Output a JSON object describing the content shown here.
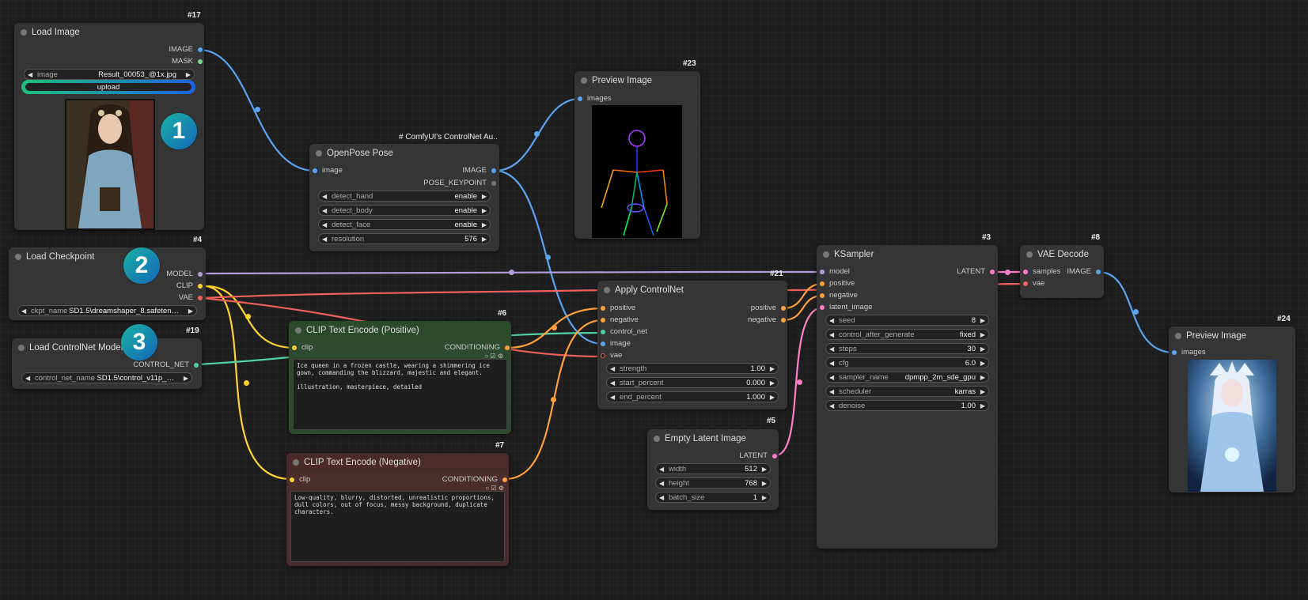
{
  "colors": {
    "image_wire": "#5aa4f0",
    "model_wire": "#b39ddb",
    "clip_wire": "#ffd233",
    "vae_wire": "#f0605d",
    "control_net_wire": "#4fd1a5",
    "conditioning_wire": "#ffa13d",
    "latent_wire": "#ff80c8",
    "positive_node_bg": "#2f4a2f",
    "negative_node_bg": "#4a2c2c",
    "upload_gradient_start": "#1ec27a",
    "upload_gradient_end": "#1e62e0"
  },
  "load_image": {
    "id": "#17",
    "title": "Load Image",
    "outputs": [
      "IMAGE",
      "MASK"
    ],
    "image_label": "image",
    "image_value": "Result_00053_@1x.jpg",
    "upload_label": "upload",
    "badge": "1"
  },
  "load_checkpoint": {
    "id": "#4",
    "title": "Load Checkpoint",
    "outputs": [
      "MODEL",
      "CLIP",
      "VAE"
    ],
    "ckpt_label": "ckpt_name",
    "ckpt_value": "SD1.5\\dreamshaper_8.safeten…",
    "badge": "2"
  },
  "load_controlnet": {
    "id": "#19",
    "title": "Load ControlNet Model",
    "output": "CONTROL_NET",
    "name_label": "control_net_name",
    "name_value": "SD1.5\\control_v11p_…",
    "badge": "3"
  },
  "openpose": {
    "group": "ComfyUI's ControlNet Au..",
    "title": "OpenPose Pose",
    "input": "image",
    "outputs": [
      "IMAGE",
      "POSE_KEYPOINT"
    ],
    "widgets": [
      {
        "label": "detect_hand",
        "value": "enable"
      },
      {
        "label": "detect_body",
        "value": "enable"
      },
      {
        "label": "detect_face",
        "value": "enable"
      },
      {
        "label": "resolution",
        "value": "576"
      }
    ]
  },
  "preview23": {
    "id": "#23",
    "title": "Preview Image",
    "input": "images"
  },
  "clip_positive": {
    "id": "#6",
    "title": "CLIP Text Encode (Positive)",
    "input": "clip",
    "output": "CONDITIONING",
    "text": "Ice queen in a frozen castle, wearing a shimmering ice gown, commanding the blizzard, majestic and elegant.\n\nillustration, masterpiece, detailed"
  },
  "clip_negative": {
    "id": "#7",
    "title": "CLIP Text Encode (Negative)",
    "input": "clip",
    "output": "CONDITIONING",
    "text": "Low-quality, blurry, distorted, unrealistic proportions, dull colors, out of focus, messy background, duplicate characters."
  },
  "apply_controlnet": {
    "id": "#21",
    "title": "Apply ControlNet",
    "inputs": [
      "positive",
      "negative",
      "control_net",
      "image",
      "vae"
    ],
    "outputs": [
      "positive",
      "negative"
    ],
    "widgets": [
      {
        "label": "strength",
        "value": "1.00"
      },
      {
        "label": "start_percent",
        "value": "0.000"
      },
      {
        "label": "end_percent",
        "value": "1.000"
      }
    ]
  },
  "empty_latent": {
    "id": "#5",
    "title": "Empty Latent Image",
    "output": "LATENT",
    "widgets": [
      {
        "label": "width",
        "value": "512"
      },
      {
        "label": "height",
        "value": "768"
      },
      {
        "label": "batch_size",
        "value": "1"
      }
    ]
  },
  "ksampler": {
    "id": "#3",
    "title": "KSampler",
    "inputs": [
      "model",
      "positive",
      "negative",
      "latent_image"
    ],
    "output": "LATENT",
    "widgets": [
      {
        "label": "seed",
        "value": "8"
      },
      {
        "label": "control_after_generate",
        "value": "fixed"
      },
      {
        "label": "steps",
        "value": "30"
      },
      {
        "label": "cfg",
        "value": "6.0"
      },
      {
        "label": "sampler_name",
        "value": "dpmpp_2m_sde_gpu"
      },
      {
        "label": "scheduler",
        "value": "karras"
      },
      {
        "label": "denoise",
        "value": "1.00"
      }
    ]
  },
  "vae_decode": {
    "id": "#8",
    "title": "VAE Decode",
    "inputs": [
      "samples",
      "vae"
    ],
    "output": "IMAGE"
  },
  "preview24": {
    "id": "#24",
    "title": "Preview Image",
    "input": "images"
  },
  "arrows": {
    "left": "◀",
    "right": "▶"
  }
}
